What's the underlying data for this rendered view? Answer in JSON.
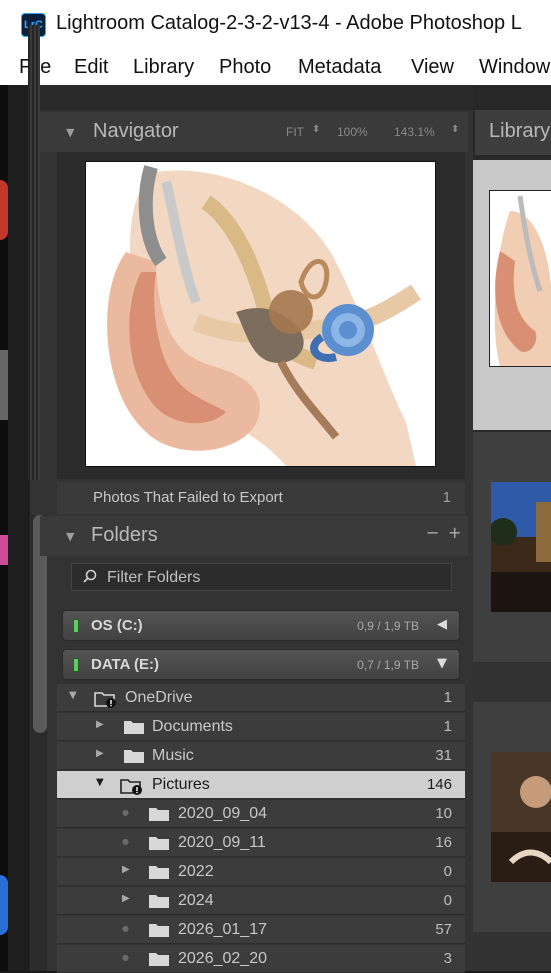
{
  "window": {
    "app_icon_text": "LrC",
    "title": "Lightroom Catalog-2-3-2-v13-4 - Adobe Photoshop L"
  },
  "menu": [
    "File",
    "Edit",
    "Library",
    "Photo",
    "Metadata",
    "View",
    "Window"
  ],
  "navigator": {
    "title": "Navigator",
    "options": [
      "FIT",
      "100%",
      "143.1%"
    ]
  },
  "collection_row": {
    "name": "Photos That Failed to Export",
    "count": "1"
  },
  "folders": {
    "title": "Folders",
    "minus": "−",
    "plus": "+",
    "filter_placeholder": "Filter Folders",
    "volumes": [
      {
        "name": "OS (C:)",
        "size": "0,9 / 1,9 TB",
        "state": "collapsed"
      },
      {
        "name": "DATA (E:)",
        "size": "0,7 / 1,9 TB",
        "state": "expanded"
      }
    ],
    "rows": [
      {
        "name": "OneDrive",
        "count": "1",
        "expander": "▼"
      },
      {
        "name": "Documents",
        "count": "1",
        "expander": "▶"
      },
      {
        "name": "Music",
        "count": "31",
        "expander": "▶"
      },
      {
        "name": "Pictures",
        "count": "146",
        "expander": "▼",
        "selected": true
      },
      {
        "name": "2020_09_04",
        "count": "10",
        "expander": ""
      },
      {
        "name": "2020_09_11",
        "count": "16",
        "expander": ""
      },
      {
        "name": "2022",
        "count": "0",
        "expander": "▶"
      },
      {
        "name": "2024",
        "count": "0",
        "expander": "▶"
      },
      {
        "name": "2026_01_17",
        "count": "57",
        "expander": ""
      },
      {
        "name": "2026_02_20",
        "count": "3",
        "expander": ""
      }
    ]
  },
  "library": {
    "label": "Library"
  },
  "colors": {
    "panel_bg": "#333333",
    "selected_row": "#cfcfcf",
    "volume_led": "#5fcc5f",
    "accent_blue": "#31a8ff"
  }
}
